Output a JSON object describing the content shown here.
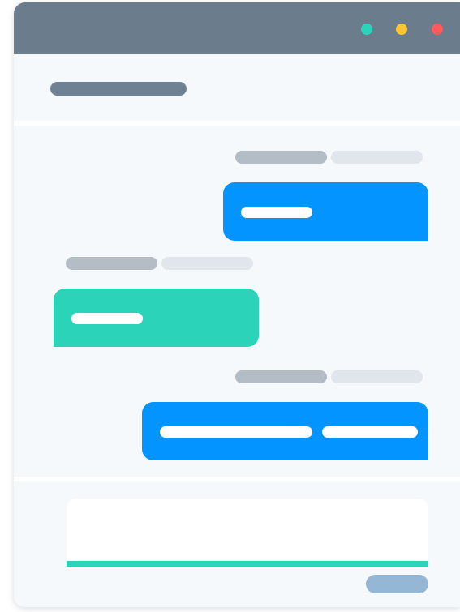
{
  "window": {
    "controls": [
      {
        "name": "green-dot",
        "color": "#2ad4b9"
      },
      {
        "name": "yellow-dot",
        "color": "#ffc533"
      },
      {
        "name": "red-dot",
        "color": "#ff5a5a"
      }
    ],
    "titlebar_color": "#6b7d8d"
  },
  "messages": [
    {
      "direction": "outgoing",
      "color": "#0394ff",
      "text_lines": 1
    },
    {
      "direction": "incoming",
      "color": "#2bd4b8",
      "text_lines": 1
    },
    {
      "direction": "outgoing",
      "color": "#0394ff",
      "text_lines": 2
    }
  ],
  "composer": {
    "accent_color": "#2bd4b8",
    "send_button_color": "#94b7d6"
  }
}
